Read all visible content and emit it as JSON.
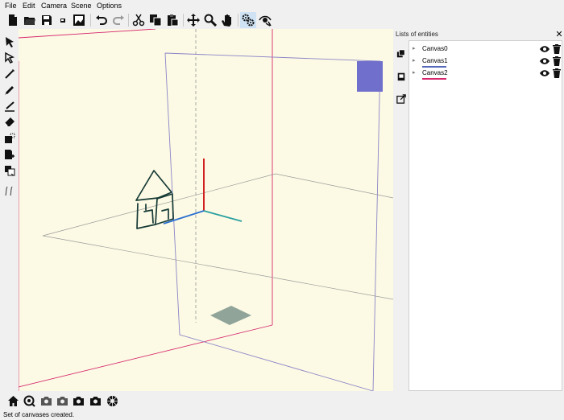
{
  "menu": [
    "File",
    "Edit",
    "Camera",
    "Scene",
    "Options"
  ],
  "toolbar": {
    "icons": [
      "new-file-icon",
      "open-folder-icon",
      "save-icon",
      "small-save-icon",
      "export-image-icon",
      "undo-icon",
      "redo-icon",
      "cut-icon",
      "copy-icon",
      "paste-icon",
      "move-icon",
      "zoom-icon",
      "pan-hand-icon",
      "settings-gears-icon",
      "view-eye-icon"
    ]
  },
  "left_tools": [
    "select-arrow-icon",
    "select-multiple-icon",
    "pen-icon",
    "brush-icon",
    "line-pen-icon",
    "eraser-icon",
    "canvas-add-icon",
    "canvas-import-icon",
    "canvas-copy-icon",
    "stroke-icon"
  ],
  "panel": {
    "title": "Lists of entities",
    "close": "✕",
    "entities": [
      {
        "label": "Canvas0",
        "underline_color": ""
      },
      {
        "label": "Canvas1",
        "underline_color": "#5468b8"
      },
      {
        "label": "Canvas2",
        "underline_color": "#d6276e"
      }
    ]
  },
  "colors": {
    "viewport_bg": "#fcfae4",
    "canvas1": "#5468b8",
    "canvas2": "#d6276e",
    "sketch": "#163a36",
    "axis_red": "#d02020",
    "axis_blue": "#2a6fd0",
    "axis_teal": "#2aa0a0",
    "square": "#7070cc",
    "floor_patch": "#90a49a"
  },
  "bottom_tools": [
    "home-view-icon",
    "zoom-fit-icon",
    "camera-icon",
    "camera-icon",
    "camera-icon",
    "camera-icon",
    "aperture-icon"
  ],
  "status": "Set of canvases created."
}
